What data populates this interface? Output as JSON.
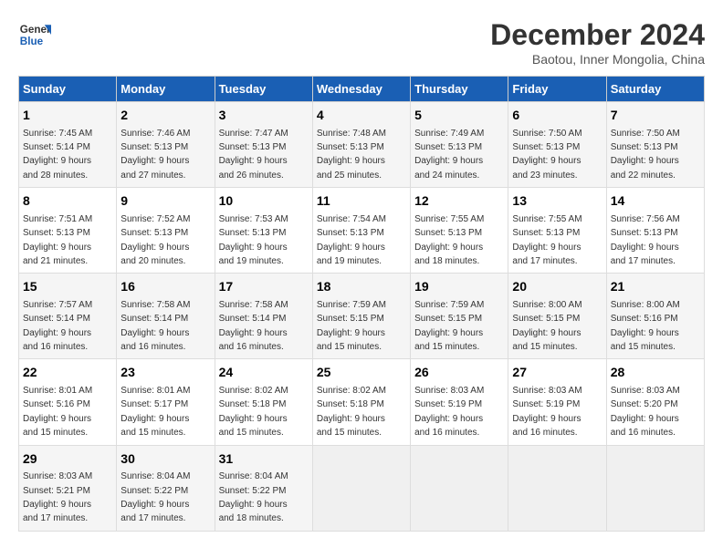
{
  "logo": {
    "line1": "General",
    "line2": "Blue"
  },
  "title": "December 2024",
  "subtitle": "Baotou, Inner Mongolia, China",
  "days_of_week": [
    "Sunday",
    "Monday",
    "Tuesday",
    "Wednesday",
    "Thursday",
    "Friday",
    "Saturday"
  ],
  "weeks": [
    [
      {
        "day": 1,
        "info": "Sunrise: 7:45 AM\nSunset: 5:14 PM\nDaylight: 9 hours\nand 28 minutes."
      },
      {
        "day": 2,
        "info": "Sunrise: 7:46 AM\nSunset: 5:13 PM\nDaylight: 9 hours\nand 27 minutes."
      },
      {
        "day": 3,
        "info": "Sunrise: 7:47 AM\nSunset: 5:13 PM\nDaylight: 9 hours\nand 26 minutes."
      },
      {
        "day": 4,
        "info": "Sunrise: 7:48 AM\nSunset: 5:13 PM\nDaylight: 9 hours\nand 25 minutes."
      },
      {
        "day": 5,
        "info": "Sunrise: 7:49 AM\nSunset: 5:13 PM\nDaylight: 9 hours\nand 24 minutes."
      },
      {
        "day": 6,
        "info": "Sunrise: 7:50 AM\nSunset: 5:13 PM\nDaylight: 9 hours\nand 23 minutes."
      },
      {
        "day": 7,
        "info": "Sunrise: 7:50 AM\nSunset: 5:13 PM\nDaylight: 9 hours\nand 22 minutes."
      }
    ],
    [
      {
        "day": 8,
        "info": "Sunrise: 7:51 AM\nSunset: 5:13 PM\nDaylight: 9 hours\nand 21 minutes."
      },
      {
        "day": 9,
        "info": "Sunrise: 7:52 AM\nSunset: 5:13 PM\nDaylight: 9 hours\nand 20 minutes."
      },
      {
        "day": 10,
        "info": "Sunrise: 7:53 AM\nSunset: 5:13 PM\nDaylight: 9 hours\nand 19 minutes."
      },
      {
        "day": 11,
        "info": "Sunrise: 7:54 AM\nSunset: 5:13 PM\nDaylight: 9 hours\nand 19 minutes."
      },
      {
        "day": 12,
        "info": "Sunrise: 7:55 AM\nSunset: 5:13 PM\nDaylight: 9 hours\nand 18 minutes."
      },
      {
        "day": 13,
        "info": "Sunrise: 7:55 AM\nSunset: 5:13 PM\nDaylight: 9 hours\nand 17 minutes."
      },
      {
        "day": 14,
        "info": "Sunrise: 7:56 AM\nSunset: 5:13 PM\nDaylight: 9 hours\nand 17 minutes."
      }
    ],
    [
      {
        "day": 15,
        "info": "Sunrise: 7:57 AM\nSunset: 5:14 PM\nDaylight: 9 hours\nand 16 minutes."
      },
      {
        "day": 16,
        "info": "Sunrise: 7:58 AM\nSunset: 5:14 PM\nDaylight: 9 hours\nand 16 minutes."
      },
      {
        "day": 17,
        "info": "Sunrise: 7:58 AM\nSunset: 5:14 PM\nDaylight: 9 hours\nand 16 minutes."
      },
      {
        "day": 18,
        "info": "Sunrise: 7:59 AM\nSunset: 5:15 PM\nDaylight: 9 hours\nand 15 minutes."
      },
      {
        "day": 19,
        "info": "Sunrise: 7:59 AM\nSunset: 5:15 PM\nDaylight: 9 hours\nand 15 minutes."
      },
      {
        "day": 20,
        "info": "Sunrise: 8:00 AM\nSunset: 5:15 PM\nDaylight: 9 hours\nand 15 minutes."
      },
      {
        "day": 21,
        "info": "Sunrise: 8:00 AM\nSunset: 5:16 PM\nDaylight: 9 hours\nand 15 minutes."
      }
    ],
    [
      {
        "day": 22,
        "info": "Sunrise: 8:01 AM\nSunset: 5:16 PM\nDaylight: 9 hours\nand 15 minutes."
      },
      {
        "day": 23,
        "info": "Sunrise: 8:01 AM\nSunset: 5:17 PM\nDaylight: 9 hours\nand 15 minutes."
      },
      {
        "day": 24,
        "info": "Sunrise: 8:02 AM\nSunset: 5:18 PM\nDaylight: 9 hours\nand 15 minutes."
      },
      {
        "day": 25,
        "info": "Sunrise: 8:02 AM\nSunset: 5:18 PM\nDaylight: 9 hours\nand 15 minutes."
      },
      {
        "day": 26,
        "info": "Sunrise: 8:03 AM\nSunset: 5:19 PM\nDaylight: 9 hours\nand 16 minutes."
      },
      {
        "day": 27,
        "info": "Sunrise: 8:03 AM\nSunset: 5:19 PM\nDaylight: 9 hours\nand 16 minutes."
      },
      {
        "day": 28,
        "info": "Sunrise: 8:03 AM\nSunset: 5:20 PM\nDaylight: 9 hours\nand 16 minutes."
      }
    ],
    [
      {
        "day": 29,
        "info": "Sunrise: 8:03 AM\nSunset: 5:21 PM\nDaylight: 9 hours\nand 17 minutes."
      },
      {
        "day": 30,
        "info": "Sunrise: 8:04 AM\nSunset: 5:22 PM\nDaylight: 9 hours\nand 17 minutes."
      },
      {
        "day": 31,
        "info": "Sunrise: 8:04 AM\nSunset: 5:22 PM\nDaylight: 9 hours\nand 18 minutes."
      },
      null,
      null,
      null,
      null
    ]
  ]
}
